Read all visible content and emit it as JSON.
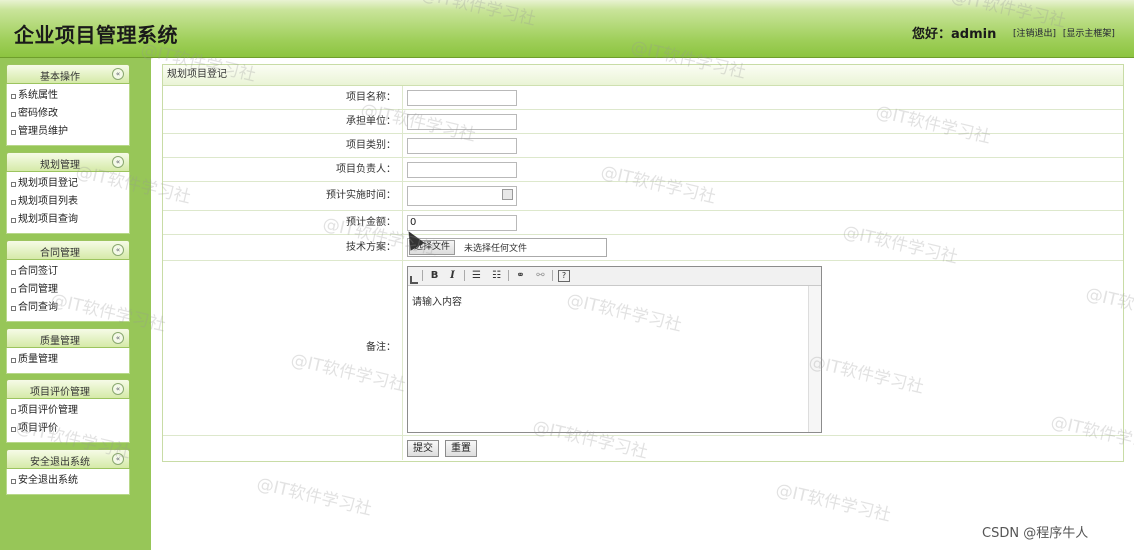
{
  "header": {
    "title": "企业项目管理系统",
    "greeting": "您好：admin",
    "links": [
      "[注销退出]",
      "[显示主框架]"
    ]
  },
  "sidebar": {
    "groups": [
      {
        "title": "基本操作",
        "toggle": "«",
        "items": [
          "系统属性",
          "密码修改",
          "管理员维护"
        ]
      },
      {
        "title": "规划管理",
        "toggle": "«",
        "items": [
          "规划项目登记",
          "规划项目列表",
          "规划项目查询"
        ]
      },
      {
        "title": "合同管理",
        "toggle": "«",
        "items": [
          "合同签订",
          "合同管理",
          "合同查询"
        ]
      },
      {
        "title": "质量管理",
        "toggle": "«",
        "items": [
          "质量管理"
        ]
      },
      {
        "title": "项目评价管理",
        "toggle": "«",
        "items": [
          "项目评价管理",
          "项目评价"
        ]
      },
      {
        "title": "安全退出系统",
        "toggle": "«",
        "items": [
          "安全退出系统"
        ]
      }
    ]
  },
  "form": {
    "heading": "规划项目登记",
    "fields": {
      "name": {
        "label": "项目名称：",
        "value": ""
      },
      "unit": {
        "label": "承担单位：",
        "value": ""
      },
      "category": {
        "label": "项目类别：",
        "value": ""
      },
      "leader": {
        "label": "项目负责人：",
        "value": ""
      },
      "date": {
        "label": "预计实施时间：",
        "value": ""
      },
      "amount": {
        "label": "预计金额：",
        "value": "0"
      },
      "plan": {
        "label": "技术方案：",
        "button": "选择文件",
        "status": "未选择任何文件"
      },
      "remark": {
        "label": "备注：",
        "placeholder": "请输入内容"
      }
    },
    "toolbar": [
      "B",
      "I"
    ],
    "submit": "提交",
    "reset": "重置"
  },
  "watermarks": [
    "@IT软件学习社"
  ],
  "credit": "CSDN @程序牛人"
}
